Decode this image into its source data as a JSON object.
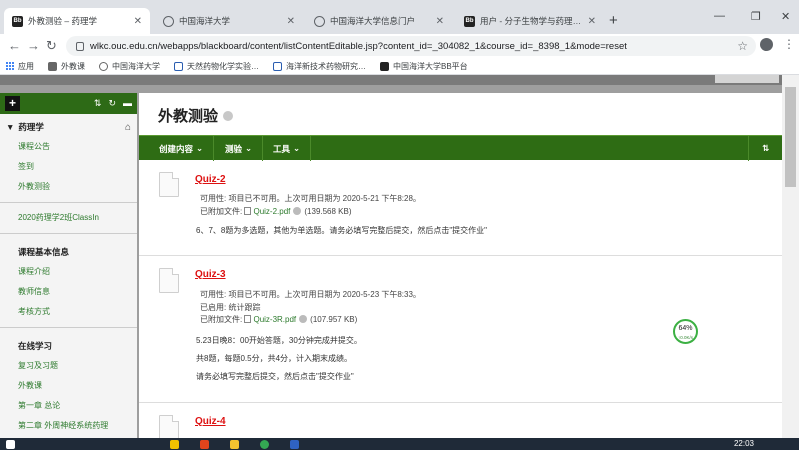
{
  "browser": {
    "tabs": [
      {
        "title": "外教测验 – 药理学",
        "icon": "blackboard-icon",
        "active": true
      },
      {
        "title": "中国海洋大学",
        "icon": "globe-icon",
        "active": false
      },
      {
        "title": "中国海洋大学信息门户",
        "icon": "globe-icon",
        "active": false
      },
      {
        "title": "用户 - 分子生物学与药理学（中…",
        "icon": "blackboard-icon",
        "active": false
      }
    ],
    "url": "wlkc.ouc.edu.cn/webapps/blackboard/content/listContentEditable.jsp?content_id=_304082_1&course_id=_8398_1&mode=reset",
    "bookmarks": [
      {
        "label": "应用",
        "icon": "apps-grid-icon",
        "color": "#4285f4"
      },
      {
        "label": "外教课",
        "icon": "bookmark-icon",
        "color": "#666666"
      },
      {
        "label": "中国海洋大学",
        "icon": "globe-icon",
        "color": "#666666"
      },
      {
        "label": "天然药物化学实验…",
        "icon": "bookmark-icon",
        "color": "#2a5db0"
      },
      {
        "label": "海洋新技术药物研究…",
        "icon": "bookmark-icon",
        "color": "#2a5db0"
      },
      {
        "label": "中国海洋大学BB平台",
        "icon": "blackboard-icon",
        "color": "#222222"
      }
    ]
  },
  "sidebar": {
    "sections": [
      {
        "title": "药理学",
        "items": [
          "课程公告",
          "签到",
          "外教测验"
        ]
      },
      {
        "title": "",
        "items": [
          "2020药理学2班ClassIn"
        ]
      },
      {
        "title": "课程基本信息",
        "items": [
          "课程介绍",
          "教师信息",
          "考核方式"
        ]
      },
      {
        "title": "在线学习",
        "items": [
          "复习及习题",
          "外教课",
          "第一章 总论",
          "第二章 外周神经系统药理"
        ]
      }
    ]
  },
  "main": {
    "title": "外教测验",
    "actions": [
      {
        "label": "创建内容"
      },
      {
        "label": "测验"
      },
      {
        "label": "工具"
      }
    ],
    "sort_icon": "⇅",
    "items": [
      {
        "title": "Quiz-2",
        "availability": "可用性: 项目已不可用。上次可用日期为 2020-5-21 下午8:28。",
        "attachment_label": "已附加文件:",
        "attachment_file": "Quiz-2.pdf",
        "attachment_size": "(139.568 KB)",
        "desc": [
          "6、7、8题为多选题，其他为单选题。请务必填写完整后提交，然后点击\"提交作业\""
        ]
      },
      {
        "title": "Quiz-3",
        "availability": "可用性: 项目已不可用。上次可用日期为 2020-5-23 下午8:33。",
        "tracking": "已启用: 统计跟踪",
        "attachment_label": "已附加文件:",
        "attachment_file": "Quiz-3R.pdf",
        "attachment_size": "(107.957 KB)",
        "desc": [
          "5.23日晚8：00开始答题，30分钟完成并提交。",
          "共8题，每题0.5分，共4分，计入期末成绩。",
          "请务必填写完整后提交，然后点击\"提交作业\""
        ]
      },
      {
        "title": "Quiz-4"
      }
    ],
    "badge": {
      "value": "64%",
      "sub": "↑0.0K/s"
    }
  },
  "taskbar": {
    "time": "22:03"
  },
  "colors": {
    "green_dark": "#2e6c14",
    "link_red": "#d11111",
    "link_green": "#2d7a2d"
  }
}
